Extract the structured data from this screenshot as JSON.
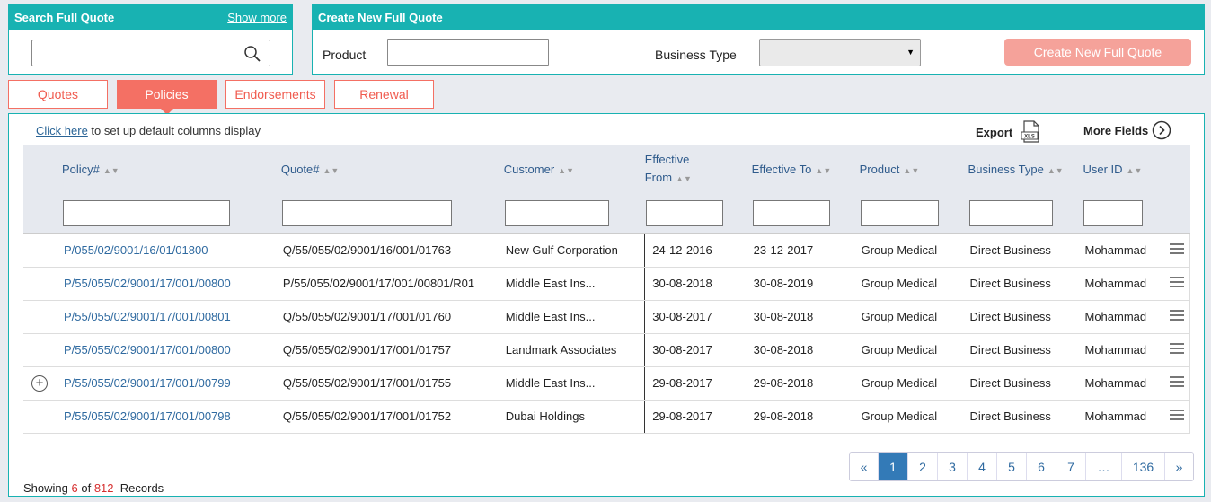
{
  "search": {
    "title": "Search Full Quote",
    "show_more": "Show more",
    "value": ""
  },
  "create": {
    "title": "Create New Full Quote",
    "product_label": "Product",
    "product_value": "",
    "business_type_label": "Business Type",
    "business_type_value": "",
    "button_label": "Create New Full Quote"
  },
  "tabs": [
    {
      "label": "Quotes",
      "active": false
    },
    {
      "label": "Policies",
      "active": true
    },
    {
      "label": "Endorsements",
      "active": false
    },
    {
      "label": "Renewal",
      "active": false
    }
  ],
  "toolbar": {
    "click_here": "Click here",
    "setup_text": "to set up default columns display",
    "export_label": "Export",
    "export_icon_text": "XLS",
    "more_fields_label": "More Fields"
  },
  "columns": [
    {
      "label": "Policy#"
    },
    {
      "label": "Quote#"
    },
    {
      "label": "Customer"
    },
    {
      "label": "Effective From"
    },
    {
      "label": "Effective To"
    },
    {
      "label": "Product"
    },
    {
      "label": "Business Type"
    },
    {
      "label": "User ID"
    }
  ],
  "rows": [
    {
      "expand": false,
      "policy": "P/055/02/9001/16/01/01800",
      "quote": "Q/55/055/02/9001/16/001/01763",
      "customer": "New Gulf Corporation",
      "eff_from": "24-12-2016",
      "eff_to": "23-12-2017",
      "product": "Group Medical",
      "business_type": "Direct Business",
      "user_id": "Mohammad"
    },
    {
      "expand": false,
      "policy": "P/55/055/02/9001/17/001/00800",
      "quote": "P/55/055/02/9001/17/001/00801/R01",
      "customer": "Middle East Ins...",
      "eff_from": "30-08-2018",
      "eff_to": "30-08-2019",
      "product": "Group Medical",
      "business_type": "Direct Business",
      "user_id": "Mohammad"
    },
    {
      "expand": false,
      "policy": "P/55/055/02/9001/17/001/00801",
      "quote": "Q/55/055/02/9001/17/001/01760",
      "customer": "Middle East Ins...",
      "eff_from": "30-08-2017",
      "eff_to": "30-08-2018",
      "product": "Group Medical",
      "business_type": "Direct Business",
      "user_id": "Mohammad"
    },
    {
      "expand": false,
      "policy": "P/55/055/02/9001/17/001/00800",
      "quote": "Q/55/055/02/9001/17/001/01757",
      "customer": "Landmark Associates",
      "eff_from": "30-08-2017",
      "eff_to": "30-08-2018",
      "product": "Group Medical",
      "business_type": "Direct Business",
      "user_id": "Mohammad"
    },
    {
      "expand": true,
      "policy": "P/55/055/02/9001/17/001/00799",
      "quote": "Q/55/055/02/9001/17/001/01755",
      "customer": "Middle East Ins...",
      "eff_from": "29-08-2017",
      "eff_to": "29-08-2018",
      "product": "Group Medical",
      "business_type": "Direct Business",
      "user_id": "Mohammad"
    },
    {
      "expand": false,
      "policy": "P/55/055/02/9001/17/001/00798",
      "quote": "Q/55/055/02/9001/17/001/01752",
      "customer": "Dubai Holdings",
      "eff_from": "29-08-2017",
      "eff_to": "29-08-2018",
      "product": "Group Medical",
      "business_type": "Direct Business",
      "user_id": "Mohammad"
    }
  ],
  "pagination": {
    "items": [
      "«",
      "1",
      "2",
      "3",
      "4",
      "5",
      "6",
      "7",
      "…",
      "136",
      "»"
    ],
    "current": "1"
  },
  "footer": {
    "showing": "Showing",
    "count": "6",
    "of": "of",
    "total": "812",
    "records": "Records"
  },
  "colors": {
    "teal": "#18b2b2",
    "coral": "#f47064",
    "link_blue": "#2f6aa0",
    "pager_active": "#337ab7"
  }
}
